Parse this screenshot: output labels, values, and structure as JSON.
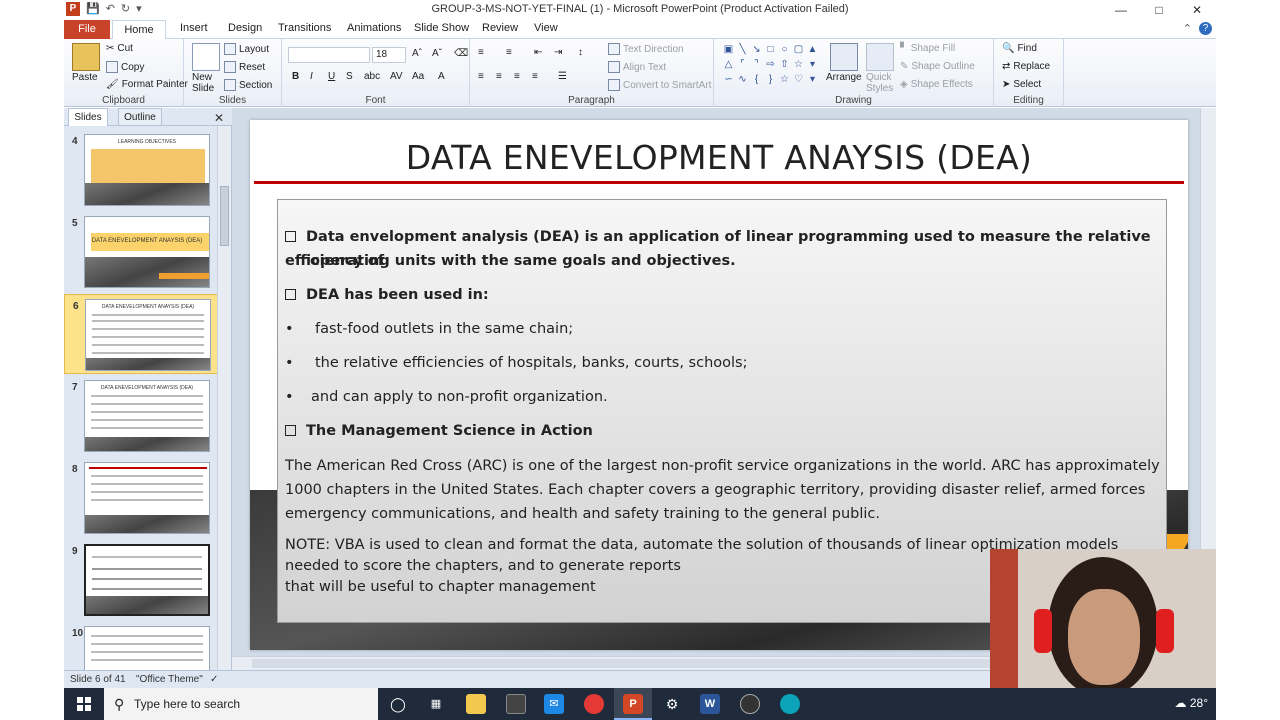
{
  "window": {
    "title": "GROUP-3-MS-NOT-YET-FINAL (1) - Microsoft PowerPoint (Product Activation Failed)",
    "app_letter": "P"
  },
  "ribbon_tabs": [
    "File",
    "Home",
    "Insert",
    "Design",
    "Transitions",
    "Animations",
    "Slide Show",
    "Review",
    "View"
  ],
  "ribbon": {
    "clipboard": {
      "label": "Clipboard",
      "paste": "Paste",
      "cut": "Cut",
      "copy": "Copy",
      "format_painter": "Format Painter"
    },
    "slides": {
      "label": "Slides",
      "new_slide": "New Slide",
      "layout": "Layout",
      "reset": "Reset",
      "section": "Section"
    },
    "font": {
      "label": "Font",
      "size": "18"
    },
    "paragraph": {
      "label": "Paragraph",
      "text_direction": "Text Direction",
      "align_text": "Align Text",
      "convert_smartart": "Convert to SmartArt"
    },
    "drawing": {
      "label": "Drawing",
      "arrange": "Arrange",
      "quick_styles": "Quick Styles",
      "shape_fill": "Shape Fill",
      "shape_outline": "Shape Outline",
      "shape_effects": "Shape Effects"
    },
    "editing": {
      "label": "Editing",
      "find": "Find",
      "replace": "Replace",
      "select": "Select"
    }
  },
  "pane": {
    "tab_slides": "Slides",
    "tab_outline": "Outline",
    "thumbnails": [
      {
        "num": "4",
        "title": "LEARNING OBJECTIVES"
      },
      {
        "num": "5",
        "title": "DATA ENEVELOPMENT ANAYSIS (DEA)"
      },
      {
        "num": "6",
        "title": "DATA ENEVELOPMENT ANAYSIS (DEA)"
      },
      {
        "num": "7",
        "title": "DATA ENEVELOPMENT ANAYSIS (DEA)"
      },
      {
        "num": "8",
        "title": ""
      },
      {
        "num": "9",
        "title": ""
      },
      {
        "num": "10",
        "title": ""
      }
    ]
  },
  "slide": {
    "title": "DATA ENEVELOPMENT ANAYSIS (DEA)",
    "p1_line1": "Data envelopment analysis (DEA) is an application of linear programming used to measure the relative efficiency of",
    "p1_line2": "operating units with the same goals and objectives.",
    "p2": "DEA has been used in:",
    "b1": "fast-food outlets in the same chain;",
    "b2": "the relative efficiencies of hospitals, banks, courts, schools;",
    "b3": "and can apply to non-profit organization.",
    "p3": "The Management Science in Action",
    "arc_line1": "The American Red Cross (ARC) is one of the largest non-profit service organizations in the world. ARC has approximately",
    "arc_line2": "1000 chapters in the United States. Each chapter covers a geographic territory, providing disaster relief, armed forces",
    "arc_line3": "emergency communications, and health and safety training to the general public.",
    "note_line1": "NOTE: VBA is used to clean and format the data, automate the solution of thousands of linear optimization models",
    "note_line2": "needed to score the chapters, and to generate reports",
    "note_line3": "that will be useful to chapter management",
    "bullet_char": "•"
  },
  "status": {
    "slide_of": "Slide 6 of 41",
    "theme": "\"Office Theme\""
  },
  "taskbar": {
    "search_placeholder": "Type here to search",
    "temperature": "28°"
  }
}
